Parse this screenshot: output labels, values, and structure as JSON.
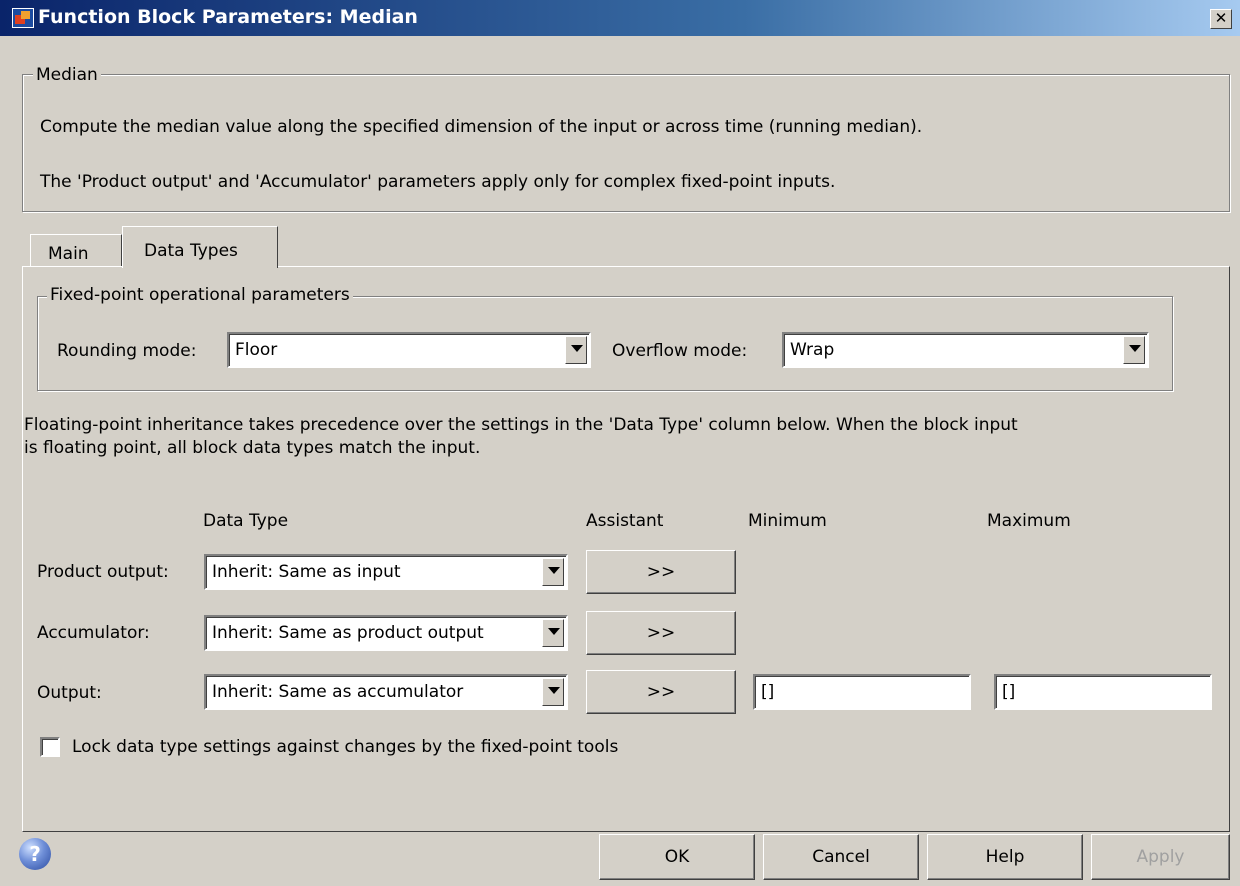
{
  "window": {
    "title": "Function Block Parameters: Median",
    "close_label": "✕"
  },
  "description": {
    "legend": "Median",
    "line1": "Compute the median value along the specified dimension of the input or across time (running median).",
    "line2": "The 'Product output' and 'Accumulator' parameters apply only for complex fixed-point inputs."
  },
  "tabs": [
    {
      "label": "Main",
      "active": false
    },
    {
      "label": "Data Types",
      "active": true
    }
  ],
  "fixed_point": {
    "legend": "Fixed-point operational parameters",
    "rounding_label": "Rounding mode:",
    "rounding_value": "Floor",
    "overflow_label": "Overflow mode:",
    "overflow_value": "Wrap"
  },
  "inheritance_note": {
    "line1": "Floating-point inheritance takes precedence over the settings in the 'Data Type' column below. When the block input",
    "line2": "is floating point, all block data types match the input."
  },
  "table": {
    "headers": {
      "data_type": "Data Type",
      "assistant": "Assistant",
      "minimum": "Minimum",
      "maximum": "Maximum"
    },
    "rows": [
      {
        "label": "Product output:",
        "data_type": "Inherit: Same as input",
        "assistant": ">>"
      },
      {
        "label": "Accumulator:",
        "data_type": "Inherit: Same as product output",
        "assistant": ">>"
      },
      {
        "label": "Output:",
        "data_type": "Inherit: Same as accumulator",
        "assistant": ">>",
        "minimum": "[]",
        "maximum": "[]"
      }
    ]
  },
  "lock": {
    "label": "Lock data type settings against changes by the fixed-point tools",
    "checked": false
  },
  "footer": {
    "help_icon_glyph": "?",
    "ok": "OK",
    "cancel": "Cancel",
    "help": "Help",
    "apply": "Apply"
  }
}
